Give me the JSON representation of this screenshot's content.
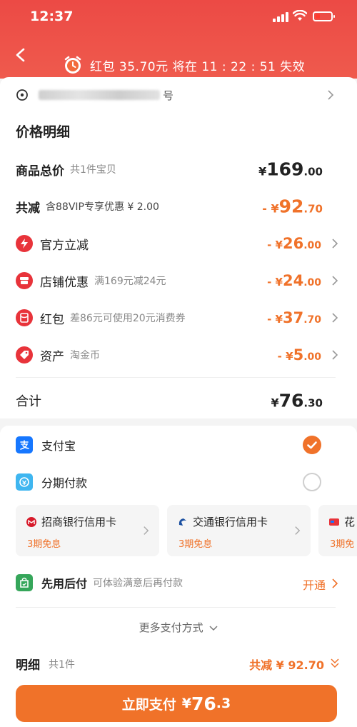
{
  "status_bar": {
    "time": "12:37"
  },
  "banner": {
    "text": "红包 35.70元 将在  11 : 22 : 51  失效"
  },
  "address": {
    "suffix": "号"
  },
  "price_detail": {
    "title": "价格明细",
    "total": {
      "label": "商品总价",
      "sub": "共1件宝贝",
      "yen": "¥",
      "int": "169",
      "dec": ".00"
    },
    "reduce": {
      "label": "共减",
      "sub": "含88VIP专享优惠 ¥ 2.00",
      "prefix": "- ¥",
      "int": "92",
      "dec": ".70"
    },
    "items": [
      {
        "label": "官方立减",
        "sub": "",
        "prefix": "- ¥",
        "int": "26",
        "dec": ".00",
        "icon": "lightning-icon"
      },
      {
        "label": "店铺优惠",
        "sub": "满169元减24元",
        "prefix": "- ¥",
        "int": "24",
        "dec": ".00",
        "icon": "shop-icon"
      },
      {
        "label": "红包",
        "sub": "差86元可使用20元消费券",
        "prefix": "- ¥",
        "int": "37",
        "dec": ".70",
        "icon": "red-packet-icon"
      },
      {
        "label": "资产",
        "sub": "淘金币",
        "prefix": "- ¥",
        "int": "5",
        "dec": ".00",
        "icon": "tag-icon"
      }
    ],
    "sum": {
      "label": "合计",
      "yen": "¥",
      "int": "76",
      "dec": ".30"
    }
  },
  "payment": {
    "methods": [
      {
        "label": "支付宝",
        "icon": "alipay-icon",
        "selected": true
      },
      {
        "label": "分期付款",
        "icon": "installment-icon",
        "selected": false
      }
    ],
    "banks": [
      {
        "name": "招商银行信用卡",
        "promo": "3期免息"
      },
      {
        "name": "交通银行信用卡",
        "promo": "3期免息"
      },
      {
        "name": "花",
        "promo": "3期免"
      }
    ],
    "credit": {
      "label": "先用后付",
      "sub": "可体验满意后再付款",
      "action": "开通"
    },
    "more": "更多支付方式"
  },
  "detail_bar": {
    "label": "明细",
    "count": "共1件",
    "saved": "共减 ¥ 92.70"
  },
  "pay_button": {
    "label": "立即支付",
    "yen": "¥",
    "int": "76",
    "dec": ".3"
  },
  "colors": {
    "header_red": "#ec4a45",
    "accent_orange": "#f0722a",
    "icon_red": "#e8333a"
  }
}
